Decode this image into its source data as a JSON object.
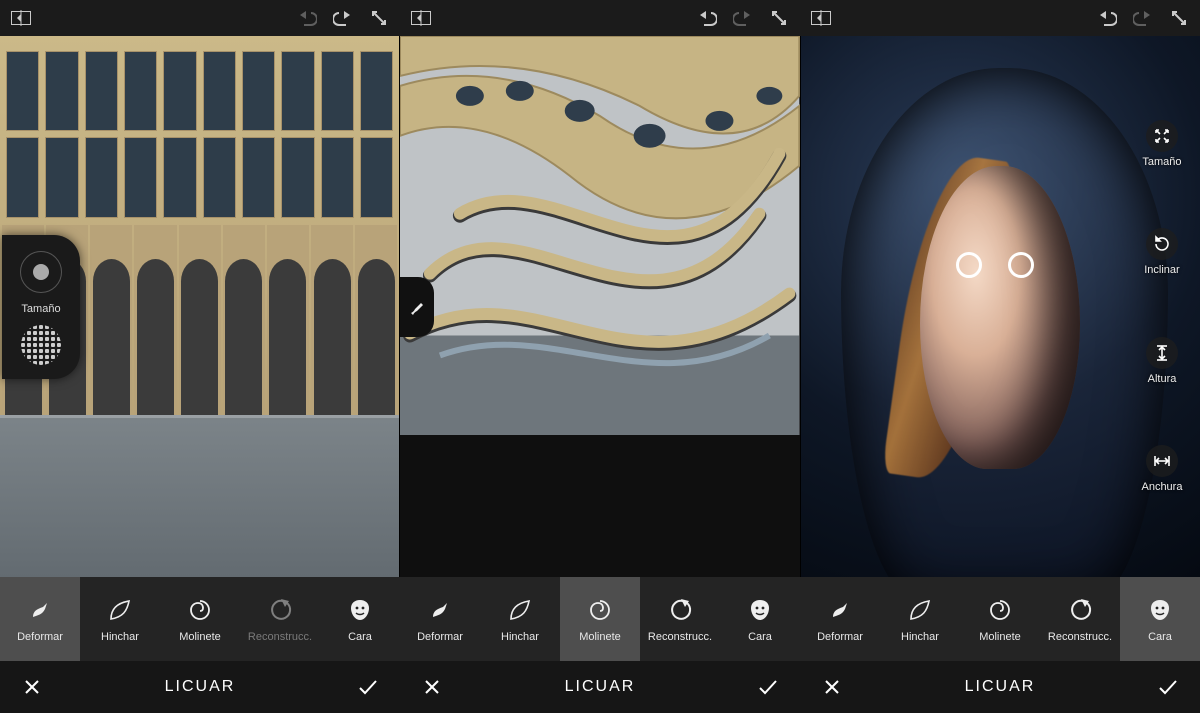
{
  "topbar": {
    "panels": [
      {
        "undo_enabled": false,
        "redo_enabled": true
      },
      {
        "undo_enabled": true,
        "redo_enabled": false
      },
      {
        "undo_enabled": true,
        "redo_enabled": false
      }
    ]
  },
  "popover": {
    "size_label": "Tamaño"
  },
  "face_tools": {
    "size": "Tamaño",
    "tilt": "Inclinar",
    "height": "Altura",
    "width": "Anchura"
  },
  "tools": {
    "deformar": "Deformar",
    "hinchar": "Hinchar",
    "molinete": "Molinete",
    "reconstrucc": "Reconstrucc.",
    "cara": "Cara"
  },
  "panels": [
    {
      "selected_tool": "deformar",
      "reconstruct_enabled": false,
      "title": "LICUAR"
    },
    {
      "selected_tool": "molinete",
      "reconstruct_enabled": true,
      "title": "LICUAR"
    },
    {
      "selected_tool": "cara",
      "reconstruct_enabled": true,
      "title": "LICUAR"
    }
  ]
}
